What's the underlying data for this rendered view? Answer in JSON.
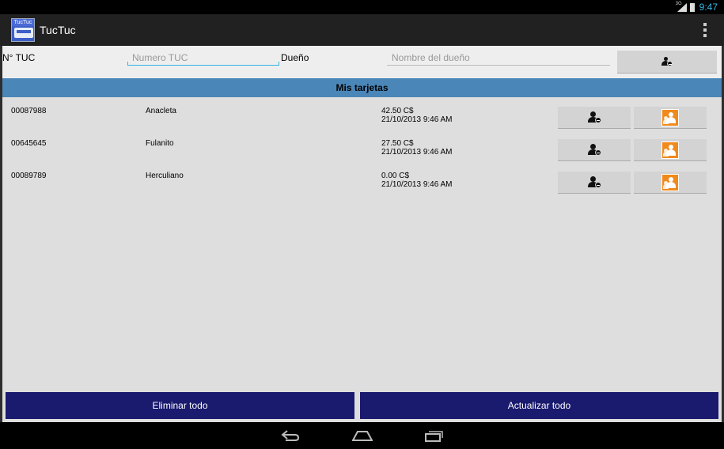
{
  "status_bar": {
    "signal_label": "3G",
    "time": "9:47"
  },
  "app": {
    "logo_text": "TucTuc",
    "title": "TucTuc"
  },
  "form": {
    "tuc_label": "N° TUC",
    "tuc_placeholder": "Numero TUC",
    "owner_label": "Dueño",
    "owner_placeholder": "Nombre del dueño",
    "add_icon": "add-user-icon"
  },
  "section": {
    "title": "Mis tarjetas"
  },
  "cards": [
    {
      "number": "00087988",
      "owner": "Anacleta",
      "balance": "42.50 C$",
      "date": "21/10/2013  9:46 AM"
    },
    {
      "number": "00645645",
      "owner": "Fulanito",
      "balance": "27.50 C$",
      "date": "21/10/2013  9:46 AM"
    },
    {
      "number": "00089789",
      "owner": "Herculiano",
      "balance": "0.00 C$",
      "date": "21/10/2013  9:46 AM"
    }
  ],
  "actions": {
    "delete_all": "Eliminar todo",
    "refresh_all": "Actualizar todo"
  },
  "colors": {
    "action_bar": "#212121",
    "section_header": "#4a86b8",
    "bottom_button": "#1a1a6e",
    "accent": "#33b5e5",
    "contacts_icon": "#f08a1c"
  }
}
